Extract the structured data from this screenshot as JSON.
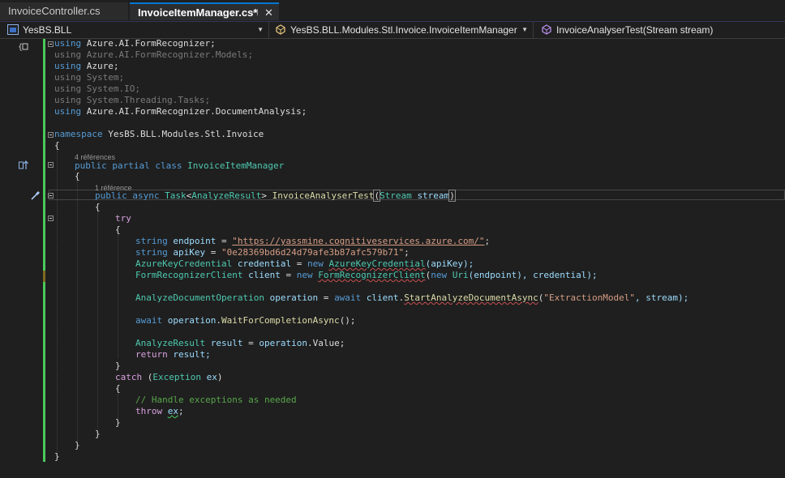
{
  "tabs": [
    {
      "label": "InvoiceController.cs",
      "active": false
    },
    {
      "label": "InvoiceItemManager.cs*",
      "active": true
    }
  ],
  "tab_icons": {
    "pin": "pin-icon",
    "close": "close-icon"
  },
  "navbar": {
    "project": "YesBS.BLL",
    "type": "YesBS.BLL.Modules.Stl.Invoice.InvoiceItemManager",
    "member": "InvoiceAnalyserTest(Stream stream)"
  },
  "codelens": {
    "class_refs": "4 références",
    "method_refs": "1 référence"
  },
  "code": {
    "l1": {
      "kw": "using",
      "ns": "Azure.AI.FormRecognizer",
      "end": ";"
    },
    "l2": {
      "kw": "using",
      "ns": "Azure.AI.FormRecognizer.Models",
      "end": ";"
    },
    "l3": {
      "kw": "using",
      "ns": "Azure",
      "end": ";"
    },
    "l4": {
      "kw": "using",
      "ns": "System",
      "end": ";"
    },
    "l5": {
      "kw": "using",
      "ns": "System.IO",
      "end": ";"
    },
    "l6": {
      "kw": "using",
      "ns": "System.Threading.Tasks",
      "end": ";"
    },
    "l7": {
      "kw": "using",
      "ns": "Azure.AI.FormRecognizer.DocumentAnalysis",
      "end": ";"
    },
    "ns_kw": "namespace",
    "ns_name": "YesBS.BLL.Modules.Stl.Invoice",
    "cls_mods": "public partial class",
    "cls_name": "InvoiceItemManager",
    "m_public": "public",
    "m_async": "async",
    "m_task": "Task",
    "m_lt": "<",
    "m_result_type": "AnalyzeResult",
    "m_gt": ">",
    "m_name": "InvoiceAnalyserTest",
    "m_paren_open": "(",
    "m_param_type": "Stream",
    "m_param": "stream",
    "m_paren_close": ")",
    "try": "try",
    "string1": "string",
    "endpoint": "endpoint",
    "eq1": " = ",
    "url": "\"https://yassmine.cognitiveservices.azure.com/\"",
    "string2": "string",
    "apikey": "apiKey",
    "eq2": " = ",
    "key": "\"0e28369bd6d24d79afe3b87afc579b71\"",
    "cred_type": "AzureKeyCredential",
    "cred_var": "credential",
    "cred_rest_a": " = ",
    "cred_new": "new",
    "cred_ctor": "AzureKeyCredential",
    "cred_args": "(apiKey);",
    "client_type": "FormRecognizerClient",
    "client_var": "client",
    "client_eq": " = ",
    "client_new": "new",
    "client_ctor": "FormRecognizerClient",
    "client_open": "(",
    "uri_new": "new",
    "uri_type": "Uri",
    "client_args": "(endpoint), credential);",
    "op_type": "AnalyzeDocumentOperation",
    "op_var": "operation",
    "op_eq": " = ",
    "op_await": "await",
    "op_client": "client",
    "op_dot": ".",
    "op_method": "StartAnalyzeDocumentAsync",
    "op_open": "(",
    "op_model": "\"ExtractionModel\"",
    "op_rest": ", stream);",
    "w_await": "await",
    "w_obj": "operation",
    "w_dot": ".",
    "w_method": "WaitForCompletionAsync",
    "w_end": "();",
    "r_type": "AnalyzeResult",
    "r_var": "result",
    "r_eq": " = ",
    "r_obj": "operation",
    "r_prop": ".Value;",
    "ret_kw": "return",
    "ret_val": "result;",
    "catch_kw": "catch",
    "catch_open": " (",
    "catch_type": "Exception",
    "catch_var": "ex",
    "catch_close": ")",
    "comment": "// Handle exceptions as needed",
    "throw_kw": "throw",
    "throw_var": "ex",
    "throw_end": ";",
    "open_brace": "{",
    "close_brace": "}"
  },
  "colors": {
    "keyword": "#569cd6",
    "control": "#d8a0df",
    "type": "#4ec9b0",
    "variable": "#9cdcfe",
    "string": "#d69d85",
    "comment": "#57a64a",
    "method": "#dcdcaa",
    "changed_bar": "#4ac95a",
    "active_tab_accent": "#0078d4"
  }
}
